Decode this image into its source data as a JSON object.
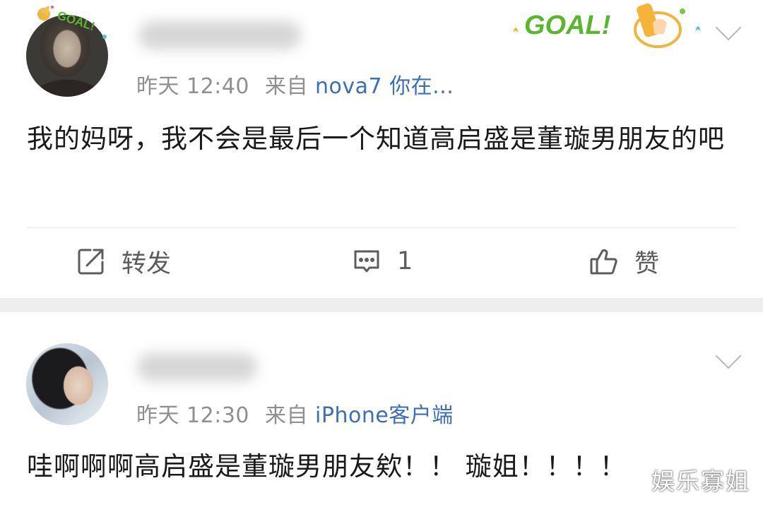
{
  "posts": [
    {
      "time": "昨天 12:40",
      "from_label": "来自",
      "source": "nova7 你在...",
      "text": "我的妈呀，我不会是最后一个知道高启盛是董璇男朋友的吧",
      "badge_text": "GOAL!"
    },
    {
      "time": "昨天 12:30",
      "from_label": "来自",
      "source": "iPhone客户端",
      "text": "哇啊啊啊高启盛是董璇男朋友欸！！ 璇姐！！！！"
    }
  ],
  "actions": {
    "repost_label": "转发",
    "comment_count": "1",
    "like_label": "赞"
  },
  "watermark": "娱乐寡姐",
  "colors": {
    "source_link": "#3b6fb6",
    "meta_text": "#8f8f8f",
    "badge_green": "#58b82b",
    "separator": "#eeeeee"
  },
  "icons": [
    "repost-icon",
    "comment-icon",
    "like-icon",
    "chevron-down-icon",
    "goal-badge-icon"
  ]
}
